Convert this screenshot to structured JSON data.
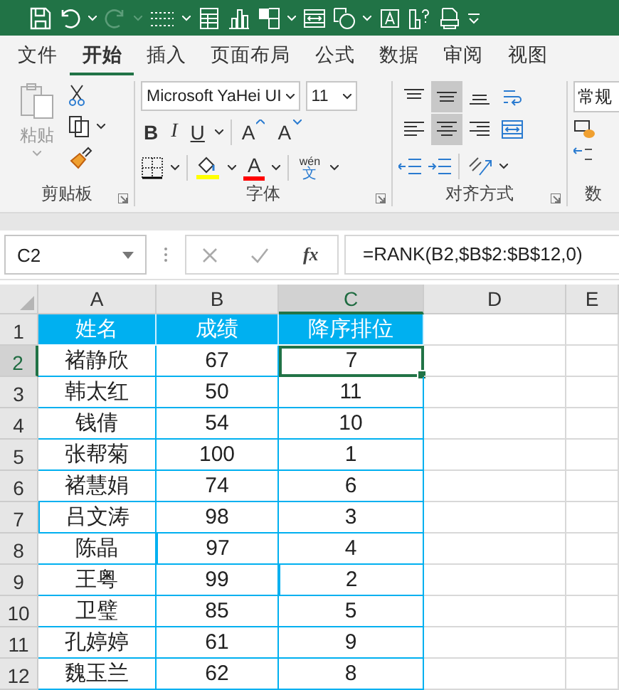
{
  "ribbon_tabs": [
    {
      "label": "文件",
      "selected": false
    },
    {
      "label": "开始",
      "selected": true
    },
    {
      "label": "插入",
      "selected": false
    },
    {
      "label": "页面布局",
      "selected": false
    },
    {
      "label": "公式",
      "selected": false
    },
    {
      "label": "数据",
      "selected": false
    },
    {
      "label": "审阅",
      "selected": false
    },
    {
      "label": "视图",
      "selected": false
    }
  ],
  "clipboard": {
    "paste": "粘贴",
    "group": "剪贴板"
  },
  "font": {
    "name": "Microsoft YaHei UI",
    "size": "11",
    "bold": "B",
    "italic": "I",
    "underline": "U",
    "grow": "A",
    "shrink": "A",
    "font_color": "A",
    "phonetic_top": "wén",
    "phonetic_bottom": "文",
    "group": "字体"
  },
  "alignment": {
    "group": "对齐方式",
    "buttons": [
      {
        "kind": "top",
        "on": false
      },
      {
        "kind": "middle",
        "on": true
      },
      {
        "kind": "bottom",
        "on": false
      },
      {
        "kind": "wrap",
        "on": false
      },
      {
        "kind": "left",
        "on": false
      },
      {
        "kind": "center",
        "on": true
      },
      {
        "kind": "right",
        "on": false
      },
      {
        "kind": "merge",
        "on": false
      }
    ]
  },
  "number": {
    "format": "常规",
    "group": "数"
  },
  "formula_bar": {
    "name_box": "C2",
    "fx": "fx",
    "formula": "=RANK(B2,$B$2:$B$12,0)"
  },
  "sheet": {
    "columns": [
      {
        "label": "A",
        "selected": false
      },
      {
        "label": "B",
        "selected": false
      },
      {
        "label": "C",
        "selected": true
      },
      {
        "label": "D",
        "selected": false
      },
      {
        "label": "E",
        "selected": false
      }
    ],
    "rows": [
      {
        "number": "1",
        "kind": "header",
        "selected": false,
        "cells": [
          "姓名",
          "成绩",
          "降序排位"
        ]
      },
      {
        "number": "2",
        "kind": "data",
        "selected": true,
        "cells": [
          "褚静欣",
          "67",
          "7"
        ]
      },
      {
        "number": "3",
        "kind": "data",
        "selected": false,
        "cells": [
          "韩太红",
          "50",
          "11"
        ]
      },
      {
        "number": "4",
        "kind": "data",
        "selected": false,
        "cells": [
          "钱倩",
          "54",
          "10"
        ]
      },
      {
        "number": "5",
        "kind": "data",
        "selected": false,
        "cells": [
          "张帮菊",
          "100",
          "1"
        ]
      },
      {
        "number": "6",
        "kind": "data",
        "selected": false,
        "cells": [
          "褚慧娟",
          "74",
          "6"
        ]
      },
      {
        "number": "7",
        "kind": "data",
        "selected": false,
        "cells": [
          "吕文涛",
          "98",
          "3"
        ]
      },
      {
        "number": "8",
        "kind": "data",
        "selected": false,
        "cells": [
          "陈晶",
          "97",
          "4"
        ]
      },
      {
        "number": "9",
        "kind": "data",
        "selected": false,
        "cells": [
          "王粤",
          "99",
          "2"
        ]
      },
      {
        "number": "10",
        "kind": "data",
        "selected": false,
        "cells": [
          "卫璧",
          "85",
          "5"
        ]
      },
      {
        "number": "11",
        "kind": "data",
        "selected": false,
        "cells": [
          "孔婷婷",
          "61",
          "9"
        ]
      },
      {
        "number": "12",
        "kind": "data",
        "selected": false,
        "cells": [
          "魏玉兰",
          "62",
          "8"
        ]
      }
    ]
  }
}
